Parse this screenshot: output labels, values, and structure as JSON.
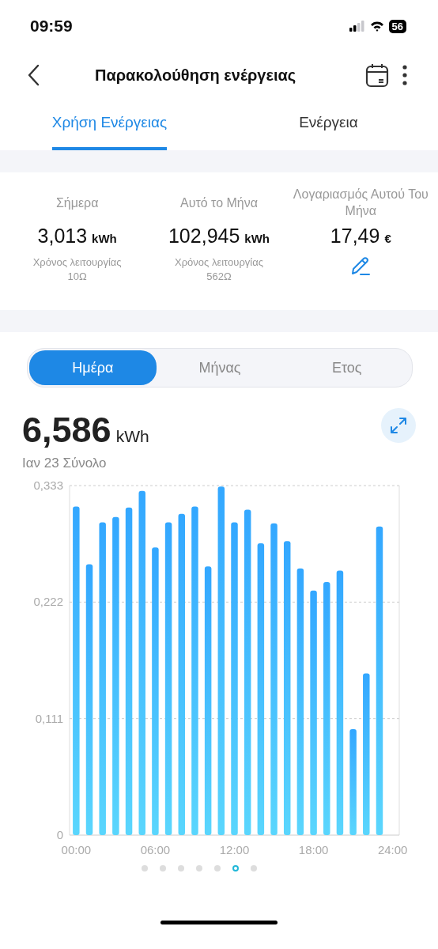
{
  "status_bar": {
    "time": "09:59",
    "battery": "56"
  },
  "header": {
    "title": "Παρακολούθηση ενέργειας"
  },
  "tabs": [
    {
      "label": "Χρήση Ενέργειας",
      "selected": true
    },
    {
      "label": "Ενέργεια",
      "selected": false
    }
  ],
  "stats": [
    {
      "kind": "usage",
      "label": "Σήμερα",
      "value": "3,013",
      "unit": "kWh",
      "caption": "Χρόνος λειτουργίας",
      "hours": "10Ω"
    },
    {
      "kind": "usage",
      "label": "Αυτό το Μήνα",
      "value": "102,945",
      "unit": "kWh",
      "caption": "Χρόνος λειτουργίας",
      "hours": "562Ω"
    },
    {
      "kind": "bill",
      "label": "Λογαριασμός Αυτού Του Μήνα",
      "value": "17,49",
      "unit": "€"
    }
  ],
  "periods": [
    {
      "label": "Ημέρα",
      "selected": true
    },
    {
      "label": "Μήνας",
      "selected": false
    },
    {
      "label": "Ετος",
      "selected": false
    }
  ],
  "total": {
    "value": "6,586",
    "unit": "kWh",
    "caption": "Ιαν 23 Σύνολο"
  },
  "chart_data": {
    "type": "bar",
    "x": [
      0,
      1,
      2,
      3,
      4,
      5,
      6,
      7,
      8,
      9,
      10,
      11,
      12,
      13,
      14,
      15,
      16,
      17,
      18,
      19,
      20,
      21,
      22,
      23
    ],
    "xlim": [
      -0.5,
      24.5
    ],
    "series": [
      {
        "color": "#33a7ff",
        "values": [
          0.313,
          0.258,
          0.298,
          0.303,
          0.312,
          0.328,
          0.274,
          0.298,
          0.306,
          0.313,
          0.256,
          0.332,
          0.298,
          0.31,
          0.278,
          0.297,
          0.28,
          0.254,
          0.233,
          0.241,
          0.252,
          0.101,
          0.154,
          0.294
        ]
      }
    ],
    "ylim": [
      0,
      0.333
    ],
    "yticks": [
      {
        "value": 0,
        "label": "0"
      },
      {
        "value": 0.111,
        "label": "0,111"
      },
      {
        "value": 0.222,
        "label": "0,222"
      },
      {
        "value": 0.333,
        "label": "0,333"
      }
    ],
    "xticks": [
      {
        "value": 0,
        "label": "00:00"
      },
      {
        "value": 6,
        "label": "06:00"
      },
      {
        "value": 12,
        "label": "12:00"
      },
      {
        "value": 18,
        "label": "18:00"
      },
      {
        "value": 24,
        "label": "24:00"
      }
    ]
  },
  "pages": [
    {
      "selected": false
    },
    {
      "selected": false
    },
    {
      "selected": false
    },
    {
      "selected": false
    },
    {
      "selected": false
    },
    {
      "selected": true
    },
    {
      "selected": false
    }
  ]
}
